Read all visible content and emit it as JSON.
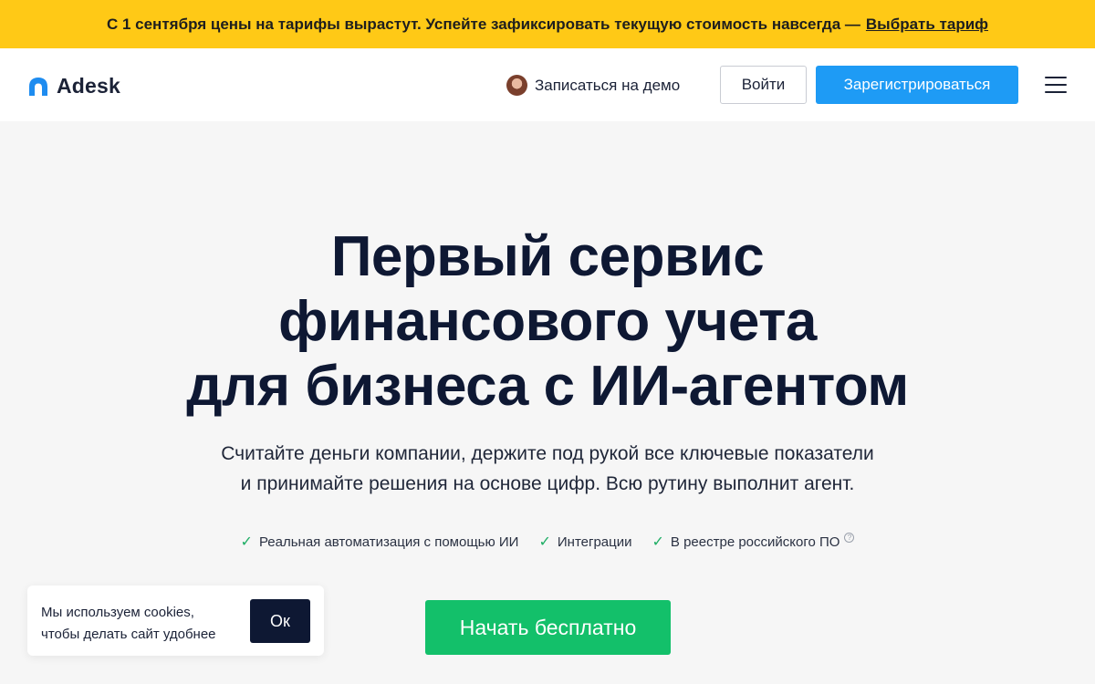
{
  "promo": {
    "text": "С 1 сентября цены на тарифы вырастут. Успейте зафиксировать текущую стоимость навсегда —",
    "link": "Выбрать тариф"
  },
  "header": {
    "logo_text": "Adesk",
    "demo_label": "Записаться на демо",
    "login_label": "Войти",
    "register_label": "Зарегистрироваться"
  },
  "hero": {
    "title_lines": [
      "Первый сервис",
      "финансового учета",
      "для бизнеса с ИИ-агентом"
    ],
    "subtitle_lines": [
      "Считайте деньги компании, держите под рукой все ключевые показатели",
      "и принимайте решения на основе цифр. Всю рутину выполнит агент."
    ],
    "features": [
      "Реальная автоматизация с помощью ИИ",
      "Интеграции",
      "В реестре российского ПО"
    ],
    "cta_label": "Начать бесплатно"
  },
  "cookie": {
    "lines": [
      "Мы используем cookies,",
      "чтобы делать сайт удобнее"
    ],
    "ok_label": "Ок"
  },
  "colors": {
    "promo_bg": "#ffc916",
    "primary_blue": "#1e9bf5",
    "cta_green": "#13c06a",
    "dark_navy": "#0e1833",
    "check_green": "#1fae65"
  },
  "icons": {
    "logo": "adesk-logo-icon",
    "avatar": "avatar",
    "menu": "hamburger-menu-icon",
    "check": "check-icon",
    "help": "question-circle-icon"
  }
}
